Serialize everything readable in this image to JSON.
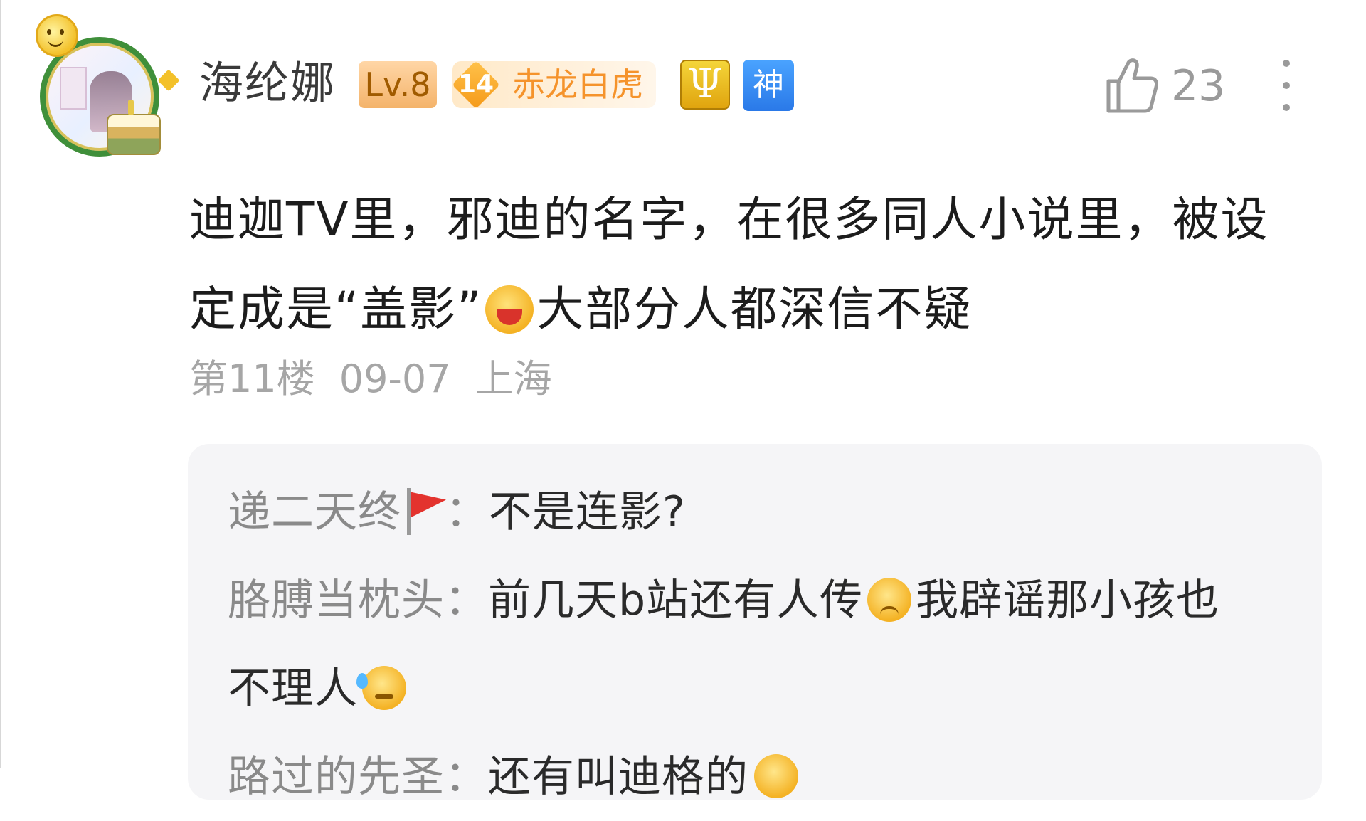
{
  "post": {
    "username": "海纶娜",
    "level": "Lv.8",
    "fan_badge": {
      "number": "14",
      "name": "赤龙白虎"
    },
    "psi_badge": "Ψ",
    "shen_badge": "神",
    "like_count": "23",
    "content_line1": "迪迦TV里，邪迪的名字，在很多同人小说里，被设",
    "content_line2_a": "定成是“盖影”",
    "content_line2_b": "大部分人都深信不疑",
    "floor": "第11楼",
    "date": "09-07",
    "location": "上海"
  },
  "replies": [
    {
      "author": "递二天终",
      "separator": "：",
      "text": "不是连影?"
    },
    {
      "author": "胳膊当枕头",
      "separator": "：",
      "text_a": "前几天b站还有人传",
      "text_b": "我辟谣那小孩也",
      "text_c": "不理人"
    },
    {
      "author": "路过的先圣",
      "separator": "：",
      "text": "还有叫迪格的"
    }
  ],
  "icons": {
    "avatar": "user-avatar",
    "like": "thumbs-up-icon",
    "more": "more-vertical-icon",
    "flag": "red-flag-icon",
    "emoji_laugh": "laughing-emoji",
    "emoji_sad": "frowning-emoji",
    "emoji_sweat": "sweat-emoji"
  },
  "colors": {
    "accent_orange": "#f5932b",
    "shen_blue": "#2a79e8",
    "meta_gray": "#a6a6a6",
    "reply_bg": "#f5f5f7"
  }
}
